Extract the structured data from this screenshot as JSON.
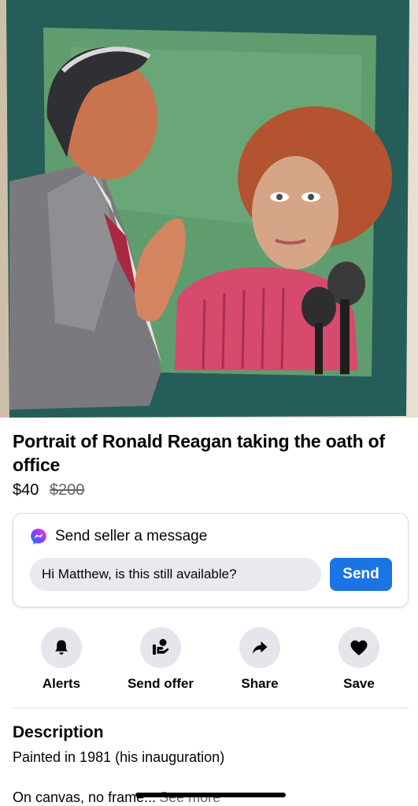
{
  "listing": {
    "title": "Portrait of Ronald Reagan taking the oath of office",
    "price": "$40",
    "original_price": "$200",
    "photo_icon": "painting-photo"
  },
  "message": {
    "heading": "Send seller a message",
    "input_value": "Hi Matthew, is this still available?",
    "send_label": "Send",
    "icon": "messenger-icon",
    "accent": "#1b74e4"
  },
  "actions": [
    {
      "label": "Alerts",
      "icon": "bell-icon"
    },
    {
      "label": "Send offer",
      "icon": "offer-hand-icon"
    },
    {
      "label": "Share",
      "icon": "share-arrow-icon"
    },
    {
      "label": "Save",
      "icon": "heart-icon"
    }
  ],
  "description": {
    "heading": "Description",
    "line1": "Painted in 1981 (his inauguration)",
    "line2": "On canvas, no frame...",
    "see_more": "See more"
  }
}
